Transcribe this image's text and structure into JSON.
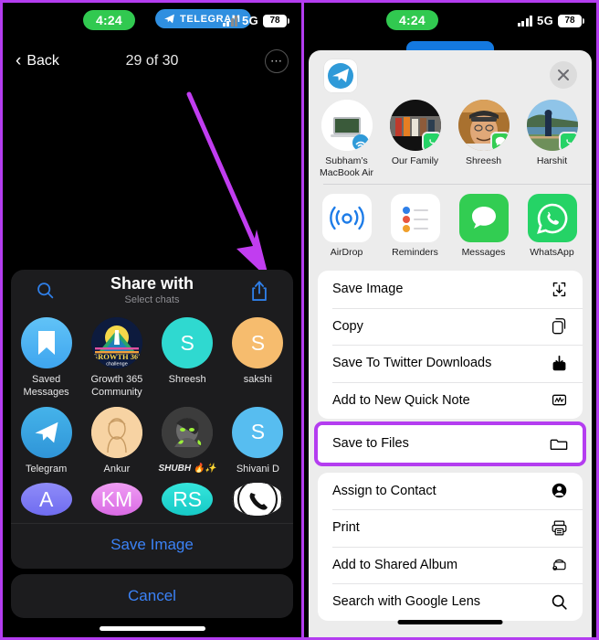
{
  "left_phone": {
    "status_bar": {
      "time": "4:24",
      "app_pill": "TELEGRAM",
      "network": "5G",
      "battery": "78"
    },
    "nav": {
      "back_label": "Back",
      "counter": "29 of 30",
      "more_icon": "more-dots-icon"
    },
    "share_sheet": {
      "title": "Share with",
      "subtitle": "Select chats",
      "search_icon": "search-icon",
      "forward_icon": "share-up-icon",
      "contacts": [
        {
          "name": "Saved Messages",
          "initials": "",
          "color": "#4cb7f2",
          "type": "bookmark"
        },
        {
          "name": "Growth 365 Community",
          "initials": "",
          "color": "#0d1b3e",
          "type": "logo"
        },
        {
          "name": "Shreesh",
          "initials": "S",
          "color": "#2fd9d0",
          "type": "initials"
        },
        {
          "name": "sakshi",
          "initials": "S",
          "color": "#f6bc6e",
          "type": "initials"
        },
        {
          "name": "Telegram",
          "initials": "",
          "color": "#3aa1e0",
          "type": "telegram"
        },
        {
          "name": "Ankur",
          "initials": "",
          "color": "#f5d0a0",
          "type": "photo"
        },
        {
          "name": "SHUBH 🔥✨",
          "initials": "",
          "color": "#4a4a4a",
          "type": "photo"
        },
        {
          "name": "Shivani D",
          "initials": "S",
          "color": "#57bdf0",
          "type": "initials"
        },
        {
          "name": "",
          "initials": "A",
          "color": "#7d7bf2",
          "type": "initials"
        },
        {
          "name": "",
          "initials": "KM",
          "color": "#e07de8",
          "type": "initials"
        },
        {
          "name": "",
          "initials": "RS",
          "color": "#2fd9d0",
          "type": "initials"
        },
        {
          "name": "",
          "initials": "",
          "color": "#ffffff",
          "type": "phone"
        }
      ],
      "save_label": "Save Image"
    },
    "cancel_label": "Cancel"
  },
  "right_phone": {
    "status_bar": {
      "time": "4:24",
      "network": "5G",
      "battery": "78"
    },
    "sheet": {
      "source_icon": "telegram-icon",
      "close_icon": "close-icon",
      "people": [
        {
          "name": "Subham’s MacBook Air",
          "badge": "airdrop"
        },
        {
          "name": "Our Family",
          "badge": "whatsapp"
        },
        {
          "name": "Shreesh",
          "badge": "messages"
        },
        {
          "name": "Harshit",
          "badge": "whatsapp"
        },
        {
          "name": "",
          "badge": ""
        }
      ],
      "apps": [
        {
          "name": "AirDrop",
          "icon": "airdrop-icon"
        },
        {
          "name": "Reminders",
          "icon": "reminders-icon"
        },
        {
          "name": "Messages",
          "icon": "messages-icon"
        },
        {
          "name": "WhatsApp",
          "icon": "whatsapp-icon"
        },
        {
          "name": "",
          "icon": "notes-icon"
        }
      ],
      "actions_primary": [
        {
          "label": "Save Image",
          "icon": "save-image-icon"
        },
        {
          "label": "Copy",
          "icon": "copy-icon"
        },
        {
          "label": "Save To Twitter Downloads",
          "icon": "download-icon"
        },
        {
          "label": "Add to New Quick Note",
          "icon": "quick-note-icon"
        }
      ],
      "highlighted_action": {
        "label": "Save to Files",
        "icon": "folder-icon",
        "highlight_color": "#b43df0"
      },
      "actions_secondary": [
        {
          "label": "Assign to Contact",
          "icon": "contact-icon"
        },
        {
          "label": "Print",
          "icon": "printer-icon"
        },
        {
          "label": "Add to Shared Album",
          "icon": "shared-album-icon"
        },
        {
          "label": "Search with Google Lens",
          "icon": "search-icon"
        }
      ]
    }
  },
  "annotation": {
    "arrow_color": "#c13df0",
    "highlight_color": "#b43df0"
  }
}
